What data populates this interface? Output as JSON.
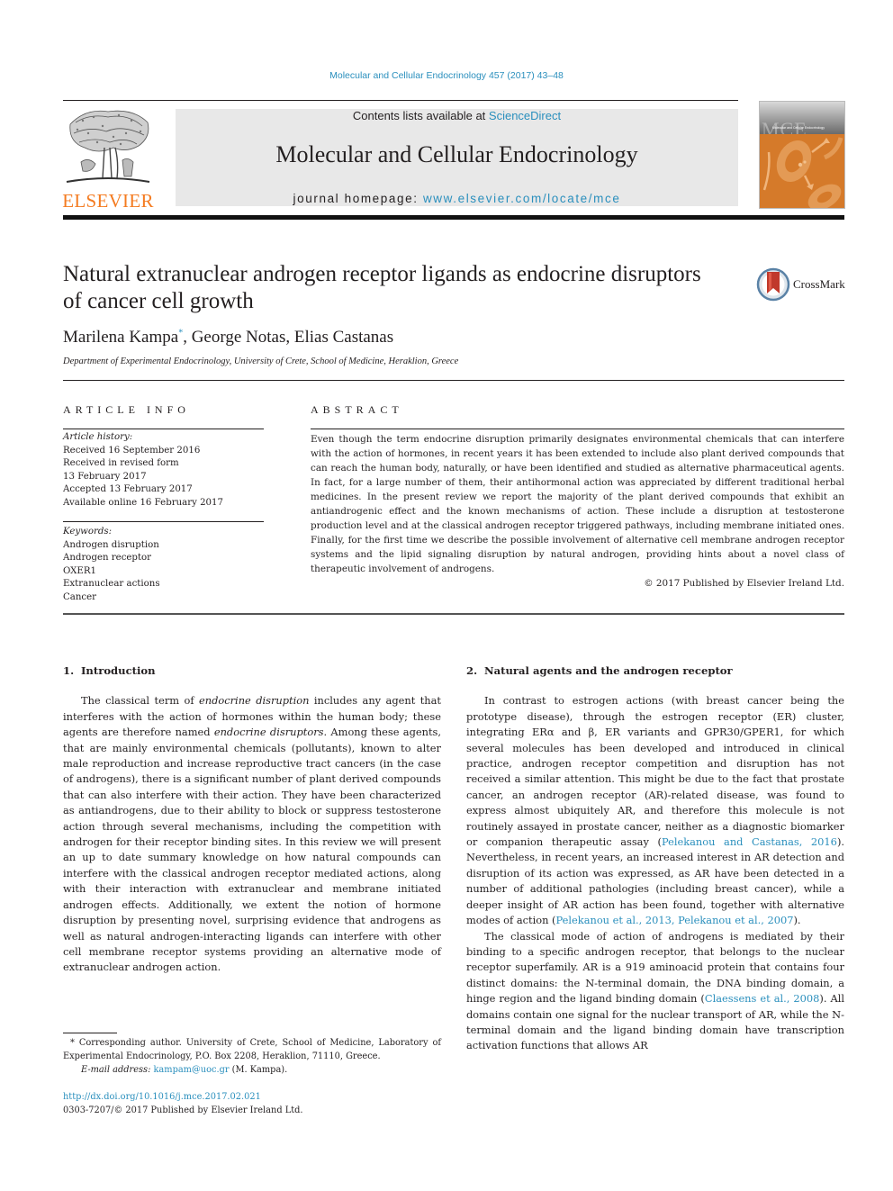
{
  "header": {
    "citation": "Molecular and Cellular Endocrinology 457 (2017) 43–48",
    "contents_prefix": "Contents lists available at ",
    "contents_link": "ScienceDirect",
    "journal_name": "Molecular and Cellular Endocrinology",
    "homepage_prefix": "journal homepage: ",
    "homepage_link": "www.elsevier.com/locate/mce",
    "publisher_logo_text": "ELSEVIER",
    "cover_text": "MCE",
    "cover_subtitle": "Molecular and Cellular Endocrinology"
  },
  "article": {
    "title": "Natural extranuclear androgen receptor ligands as endocrine disruptors of cancer cell growth",
    "crossmark_label": "CrossMark",
    "authors": [
      {
        "name": "Marilena Kampa",
        "mark": "*"
      },
      {
        "name": "George Notas",
        "mark": ""
      },
      {
        "name": "Elias Castanas",
        "mark": ""
      }
    ],
    "author_sep": ", ",
    "affiliation": "Department of Experimental Endocrinology, University of Crete, School of Medicine, Heraklion, Greece"
  },
  "article_info": {
    "heading": "ARTICLE INFO",
    "history_label": "Article history:",
    "history": [
      "Received 16 September 2016",
      "Received in revised form",
      "13 February 2017",
      "Accepted 13 February 2017",
      "Available online 16 February 2017"
    ],
    "keywords_label": "Keywords:",
    "keywords": [
      "Androgen disruption",
      "Androgen receptor",
      "OXER1",
      "Extranuclear actions",
      "Cancer"
    ]
  },
  "abstract": {
    "heading": "ABSTRACT",
    "text": "Even though the term endocrine disruption primarily designates environmental chemicals that can interfere with the action of hormones, in recent years it has been extended to include also plant derived compounds that can reach the human body, naturally, or have been identified and studied as alternative pharmaceutical agents. In fact, for a large number of them, their antihormonal action was appreciated by different traditional herbal medicines. In the present review we report the majority of the plant derived compounds that exhibit an antiandrogenic effect and the known mechanisms of action. These include a disruption at testosterone production level and at the classical androgen receptor triggered pathways, including membrane initiated ones. Finally, for the first time we describe the possible involvement of alternative cell membrane androgen receptor systems and the lipid signaling disruption by natural androgen, providing hints about a novel class of therapeutic involvement of androgens.",
    "copyright": "© 2017 Published by Elsevier Ireland Ltd."
  },
  "sections": {
    "intro": {
      "number": "1.",
      "title": "Introduction",
      "p1_a": "The classical term of ",
      "p1_em1": "endocrine disruption",
      "p1_b": " includes any agent that interferes with the action of hormones within the human body; these agents are therefore named ",
      "p1_em2": "endocrine disruptors",
      "p1_c": ". Among these agents, that are mainly environmental chemicals (pollutants), known to alter male reproduction and increase reproductive tract cancers (in the case of androgens), there is a significant number of plant derived compounds that can also interfere with their action. They have been characterized as antiandrogens, due to their ability to block or suppress testosterone action through several mecha­nisms, including the competition with androgen for their receptor binding sites. In this review we will present an up to date summary knowledge on how natural compounds can interfere with the classical androgen receptor mediated actions, along with their interaction with extranuclear and membrane initiated androgen effects. Additionally, we extent the notion of hormone disruption by presenting novel, surprising evidence that androgens as well as natural androgen-interacting ligands can interfere with other cell membrane receptor systems providing an alternative mode of extranuclear androgen action."
    },
    "natural": {
      "number": "2.",
      "title": "Natural agents and the androgen receptor",
      "p1_a": "In contrast to estrogen actions (with breast cancer being the prototype disease), through the estrogen receptor (ER) cluster, integrating ERα and β, ER variants and GPR30/GPER1, for which several molecules has been developed and introduced in clinical practice, androgen receptor competition and disruption has not received a similar attention. This might be due to the fact that prostate cancer, an androgen receptor (AR)-related disease, was found to express almost ubiquitely AR, and therefore this molecule is not routinely assayed in prostate cancer, neither as a diagnostic biomarker or companion therapeutic assay (",
      "p1_ref1": "Pelekanou and Castanas, 2016",
      "p1_b": "). Nevertheless, in recent years, an increased inter­est in AR detection and disruption of its action was expressed, as AR have been detected in a number of additional pathologies (including breast cancer), while a deeper insight of AR action has been found, together with alternative modes of action (",
      "p1_ref2": "Pelekanou et al., 2013, Pelekanou et al., 2007",
      "p1_c": ").",
      "p2_a": "The classical mode of action of androgens is mediated by their binding to a specific androgen receptor, that belongs to the nuclear receptor superfamily. AR is a 919 aminoacid protein that contains four distinct domains: the N-terminal domain, the DNA binding domain, a hinge region and the ligand binding domain (",
      "p2_ref1": "Claessens et al., 2008",
      "p2_b": "). All domains contain one signal for the nuclear trans­port of AR, while the N-terminal domain and the ligand binding domain have transcription activation functions that allows AR"
    }
  },
  "footnote": {
    "corresponding": "* Corresponding author. University of Crete, School of Medicine, Laboratory of Experimental Endocrinology, P.O. Box 2208, Heraklion, 71110, Greece.",
    "email_label": "E-mail address: ",
    "email": "kampam@uoc.gr",
    "email_suffix": " (M. Kampa).",
    "doi": "http://dx.doi.org/10.1016/j.mce.2017.02.021",
    "issn_line": "0303-7207/© 2017 Published by Elsevier Ireland Ltd."
  },
  "colors": {
    "link": "#2a8fbd",
    "elsevier_orange": "#f47b20",
    "masthead_bg": "#e8e8e8",
    "cover_orange": "#d57a2a"
  }
}
